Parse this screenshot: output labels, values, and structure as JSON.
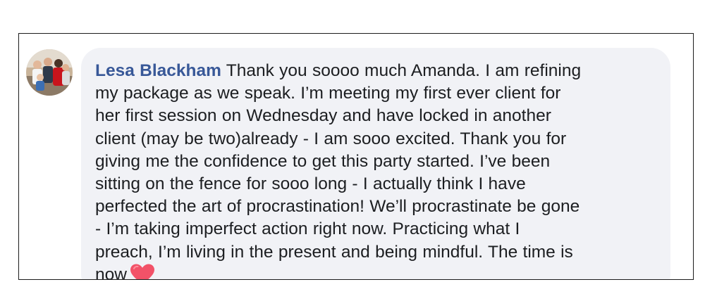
{
  "comment": {
    "author_name": "Lesa Blackham",
    "text_lines": [
      "Thank you soooo much Amanda. I am refining",
      "my package as we speak. I’m meeting my first ever client for",
      "her first session on Wednesday and have locked in another",
      "client (may be two)already - I am sooo excited. Thank you for",
      "giving me the confidence to get this party started. I’ve been",
      "sitting on the fence for sooo long - I actually think I have",
      "perfected the art of procrastination! We’ll procrastinate be gone",
      "- I’m taking imperfect action right now. Practicing what I",
      "preach, I’m living in the present and being mindful. The time is",
      "now"
    ],
    "emoji": "heart-emoji"
  },
  "colors": {
    "author": "#385898",
    "text": "#1c1e21",
    "bubble_background": "#f1f2f6",
    "heart": "#f25268"
  }
}
